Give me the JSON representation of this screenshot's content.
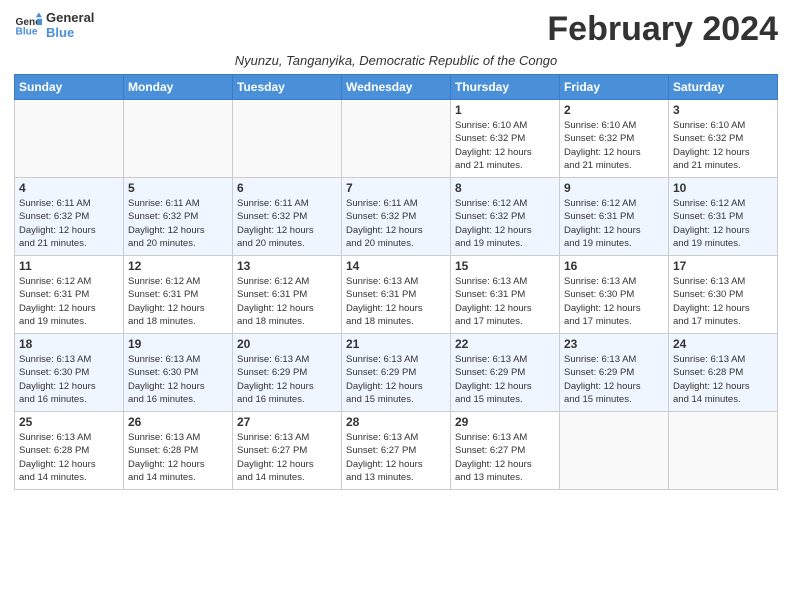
{
  "header": {
    "logo_line1": "General",
    "logo_line2": "Blue",
    "month_title": "February 2024",
    "subtitle": "Nyunzu, Tanganyika, Democratic Republic of the Congo"
  },
  "days_of_week": [
    "Sunday",
    "Monday",
    "Tuesday",
    "Wednesday",
    "Thursday",
    "Friday",
    "Saturday"
  ],
  "weeks": [
    [
      {
        "day": "",
        "info": ""
      },
      {
        "day": "",
        "info": ""
      },
      {
        "day": "",
        "info": ""
      },
      {
        "day": "",
        "info": ""
      },
      {
        "day": "1",
        "info": "Sunrise: 6:10 AM\nSunset: 6:32 PM\nDaylight: 12 hours\nand 21 minutes."
      },
      {
        "day": "2",
        "info": "Sunrise: 6:10 AM\nSunset: 6:32 PM\nDaylight: 12 hours\nand 21 minutes."
      },
      {
        "day": "3",
        "info": "Sunrise: 6:10 AM\nSunset: 6:32 PM\nDaylight: 12 hours\nand 21 minutes."
      }
    ],
    [
      {
        "day": "4",
        "info": "Sunrise: 6:11 AM\nSunset: 6:32 PM\nDaylight: 12 hours\nand 21 minutes."
      },
      {
        "day": "5",
        "info": "Sunrise: 6:11 AM\nSunset: 6:32 PM\nDaylight: 12 hours\nand 20 minutes."
      },
      {
        "day": "6",
        "info": "Sunrise: 6:11 AM\nSunset: 6:32 PM\nDaylight: 12 hours\nand 20 minutes."
      },
      {
        "day": "7",
        "info": "Sunrise: 6:11 AM\nSunset: 6:32 PM\nDaylight: 12 hours\nand 20 minutes."
      },
      {
        "day": "8",
        "info": "Sunrise: 6:12 AM\nSunset: 6:32 PM\nDaylight: 12 hours\nand 19 minutes."
      },
      {
        "day": "9",
        "info": "Sunrise: 6:12 AM\nSunset: 6:31 PM\nDaylight: 12 hours\nand 19 minutes."
      },
      {
        "day": "10",
        "info": "Sunrise: 6:12 AM\nSunset: 6:31 PM\nDaylight: 12 hours\nand 19 minutes."
      }
    ],
    [
      {
        "day": "11",
        "info": "Sunrise: 6:12 AM\nSunset: 6:31 PM\nDaylight: 12 hours\nand 19 minutes."
      },
      {
        "day": "12",
        "info": "Sunrise: 6:12 AM\nSunset: 6:31 PM\nDaylight: 12 hours\nand 18 minutes."
      },
      {
        "day": "13",
        "info": "Sunrise: 6:12 AM\nSunset: 6:31 PM\nDaylight: 12 hours\nand 18 minutes."
      },
      {
        "day": "14",
        "info": "Sunrise: 6:13 AM\nSunset: 6:31 PM\nDaylight: 12 hours\nand 18 minutes."
      },
      {
        "day": "15",
        "info": "Sunrise: 6:13 AM\nSunset: 6:31 PM\nDaylight: 12 hours\nand 17 minutes."
      },
      {
        "day": "16",
        "info": "Sunrise: 6:13 AM\nSunset: 6:30 PM\nDaylight: 12 hours\nand 17 minutes."
      },
      {
        "day": "17",
        "info": "Sunrise: 6:13 AM\nSunset: 6:30 PM\nDaylight: 12 hours\nand 17 minutes."
      }
    ],
    [
      {
        "day": "18",
        "info": "Sunrise: 6:13 AM\nSunset: 6:30 PM\nDaylight: 12 hours\nand 16 minutes."
      },
      {
        "day": "19",
        "info": "Sunrise: 6:13 AM\nSunset: 6:30 PM\nDaylight: 12 hours\nand 16 minutes."
      },
      {
        "day": "20",
        "info": "Sunrise: 6:13 AM\nSunset: 6:29 PM\nDaylight: 12 hours\nand 16 minutes."
      },
      {
        "day": "21",
        "info": "Sunrise: 6:13 AM\nSunset: 6:29 PM\nDaylight: 12 hours\nand 15 minutes."
      },
      {
        "day": "22",
        "info": "Sunrise: 6:13 AM\nSunset: 6:29 PM\nDaylight: 12 hours\nand 15 minutes."
      },
      {
        "day": "23",
        "info": "Sunrise: 6:13 AM\nSunset: 6:29 PM\nDaylight: 12 hours\nand 15 minutes."
      },
      {
        "day": "24",
        "info": "Sunrise: 6:13 AM\nSunset: 6:28 PM\nDaylight: 12 hours\nand 14 minutes."
      }
    ],
    [
      {
        "day": "25",
        "info": "Sunrise: 6:13 AM\nSunset: 6:28 PM\nDaylight: 12 hours\nand 14 minutes."
      },
      {
        "day": "26",
        "info": "Sunrise: 6:13 AM\nSunset: 6:28 PM\nDaylight: 12 hours\nand 14 minutes."
      },
      {
        "day": "27",
        "info": "Sunrise: 6:13 AM\nSunset: 6:27 PM\nDaylight: 12 hours\nand 14 minutes."
      },
      {
        "day": "28",
        "info": "Sunrise: 6:13 AM\nSunset: 6:27 PM\nDaylight: 12 hours\nand 13 minutes."
      },
      {
        "day": "29",
        "info": "Sunrise: 6:13 AM\nSunset: 6:27 PM\nDaylight: 12 hours\nand 13 minutes."
      },
      {
        "day": "",
        "info": ""
      },
      {
        "day": "",
        "info": ""
      }
    ]
  ]
}
